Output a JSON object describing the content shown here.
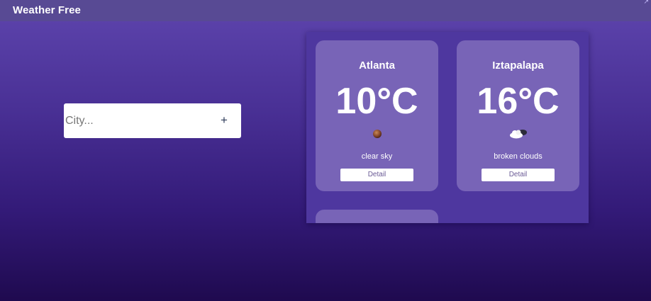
{
  "app": {
    "title": "Weather Free",
    "corner_icon": "expand-icon"
  },
  "search": {
    "placeholder": "City...",
    "value": "",
    "add_label": "+"
  },
  "cards": [
    {
      "city": "Atlanta",
      "temperature": "10°C",
      "description": "clear sky",
      "icon": "clear-sky-icon",
      "button_label": "Detail"
    },
    {
      "city": "Iztapalapa",
      "temperature": "16°C",
      "description": "broken clouds",
      "icon": "broken-clouds-icon",
      "button_label": "Detail"
    }
  ],
  "colors": {
    "topbar": "#584a94",
    "background_top": "#5e45ae",
    "background_bottom": "#1f0a4f",
    "panel": "#4e379f",
    "card": "#7864b7",
    "button_text": "#6a5a95"
  }
}
